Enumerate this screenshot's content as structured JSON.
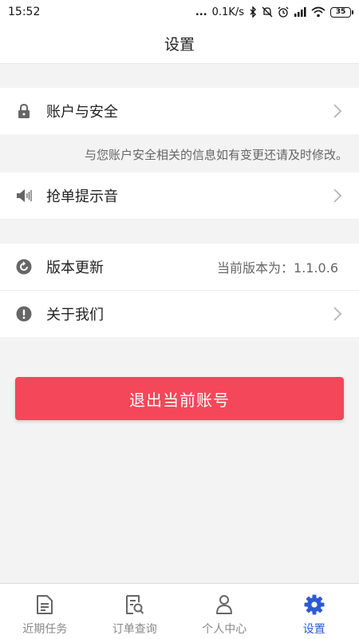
{
  "status_bar": {
    "time": "15:52",
    "dots": "...",
    "speed": "0.1K/s",
    "battery": "35",
    "icons": [
      "bluetooth-icon",
      "mute-icon",
      "alarm-icon",
      "signal-icon",
      "wifi-icon",
      "battery-icon"
    ]
  },
  "nav": {
    "title": "设置"
  },
  "settings": {
    "account_security": {
      "label": "账户与安全",
      "icon": "lock-icon"
    },
    "account_hint": "与您账户安全相关的信息如有变更还请及时修改。",
    "order_sound": {
      "label": "抢单提示音",
      "icon": "speaker-icon"
    },
    "version_update": {
      "label": "版本更新",
      "value": "当前版本为：1.1.0.6",
      "icon": "refresh-icon"
    },
    "about_us": {
      "label": "关于我们",
      "icon": "info-icon"
    }
  },
  "logout": {
    "label": "退出当前账号"
  },
  "tabs": [
    {
      "label": "近期任务",
      "icon": "document-icon",
      "active": false
    },
    {
      "label": "订单查询",
      "icon": "search-document-icon",
      "active": false
    },
    {
      "label": "个人中心",
      "icon": "person-icon",
      "active": false
    },
    {
      "label": "设置",
      "icon": "gear-icon",
      "active": true
    }
  ],
  "colors": {
    "accent": "#2d5bd0",
    "logout": "#f4475a",
    "icon_gray": "#666666",
    "background": "#f3f3f3"
  }
}
